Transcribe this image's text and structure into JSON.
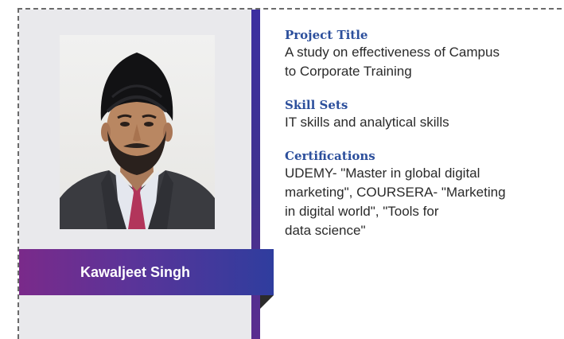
{
  "profile": {
    "name": "Kawaljeet Singh"
  },
  "sections": [
    {
      "title": "Project Title",
      "body_lines": [
        "A study on effectiveness of Campus",
        "to Corporate Training"
      ]
    },
    {
      "title": "Skill Sets",
      "body_lines": [
        "IT skills and analytical skills"
      ]
    },
    {
      "title": "Certifications",
      "body_lines": [
        "UDEMY- \"Master in global digital",
        "marketing\", COURSERA- \"Marketing",
        "in digital world\", \"Tools for",
        "data science\""
      ]
    }
  ],
  "colors": {
    "heading": "#2c4f9c",
    "banner_start": "#7a2a8a",
    "banner_end": "#2f3d9e",
    "divider": "#3c2fa0",
    "panel": "#e9e9ec"
  }
}
